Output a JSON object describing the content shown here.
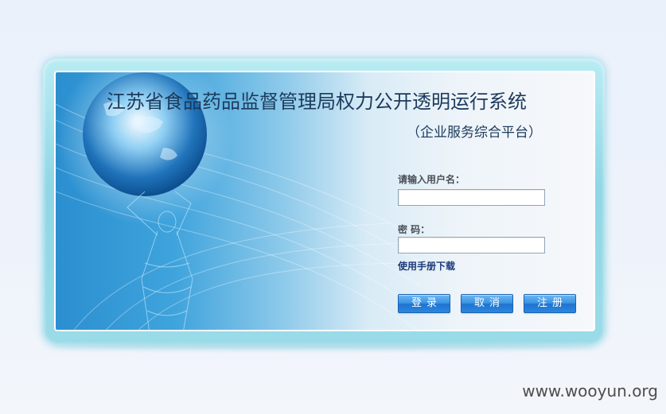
{
  "header": {
    "title": "江苏省食品药品监督管理局权力公开透明运行系统",
    "subtitle": "（企业服务综合平台）"
  },
  "login_form": {
    "username_label": "请输入用户名：",
    "username_value": "",
    "password_label": "密  码：",
    "password_value": "",
    "manual_link": "使用手册下载"
  },
  "buttons": {
    "login": "登录",
    "cancel": "取消",
    "register": "注册"
  },
  "watermark": "www.wooyun.org",
  "colors": {
    "title": "#1c3a5c",
    "button": "#2a86de",
    "frame": "#8fd6e6",
    "link": "#1d3a7a"
  },
  "icons": {
    "hero_art": "globe-and-figure-illustration"
  }
}
